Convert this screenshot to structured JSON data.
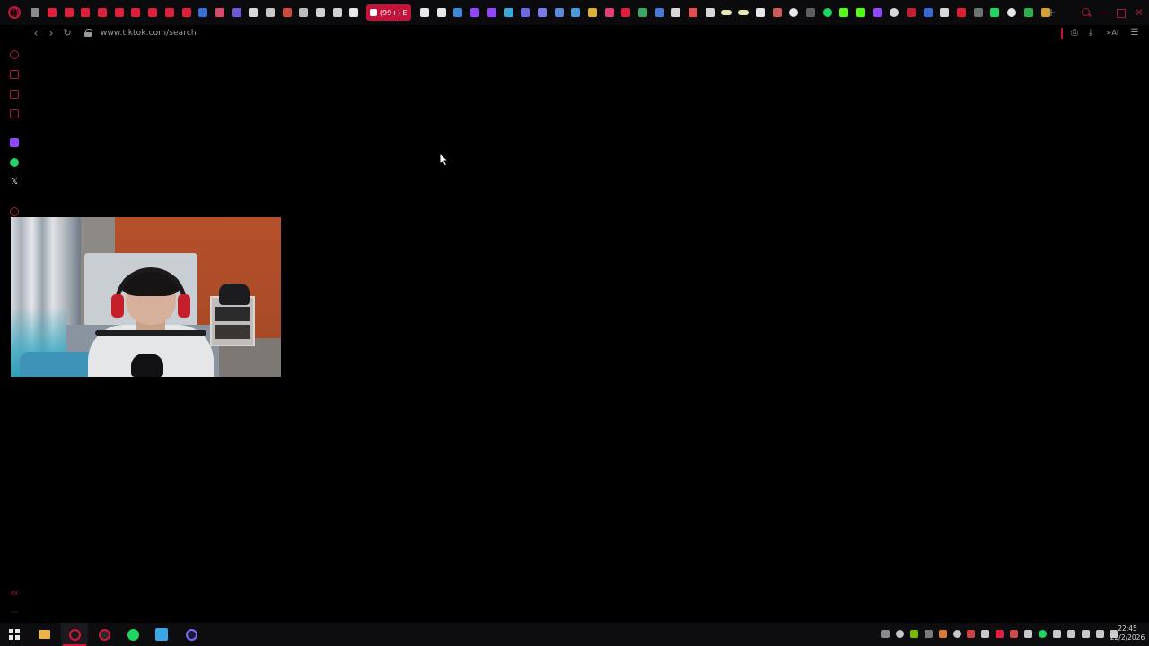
{
  "browser": {
    "active_tab_label": "(99+) E",
    "new_tab_glyph": "+",
    "url": "www.tiktok.com/search",
    "ai_label": "AI",
    "theme_accent": "#c4133a"
  },
  "tab_favicons": [
    {
      "icon": "mail-icon",
      "color": "#8a8a8a"
    },
    {
      "icon": "youtube-icon",
      "color": "#e0203a"
    },
    {
      "icon": "youtube-icon",
      "color": "#e0203a"
    },
    {
      "icon": "youtube-icon",
      "color": "#e0203a"
    },
    {
      "icon": "youtube-icon",
      "color": "#e0203a"
    },
    {
      "icon": "youtube-icon",
      "color": "#e0203a"
    },
    {
      "icon": "youtube-icon",
      "color": "#e0203a"
    },
    {
      "icon": "youtube-icon",
      "color": "#e0203a"
    },
    {
      "icon": "youtube-icon",
      "color": "#e0203a"
    },
    {
      "icon": "youtube-icon",
      "color": "#e0203a"
    },
    {
      "icon": "facebook-icon",
      "color": "#3b6fd8"
    },
    {
      "icon": "app-icon",
      "color": "#d64a6a"
    },
    {
      "icon": "app-icon",
      "color": "#6a5ad8"
    },
    {
      "icon": "document-icon",
      "color": "#d8d8d8"
    },
    {
      "icon": "app-icon",
      "color": "#c8c8c8"
    },
    {
      "icon": "mail-icon",
      "color": "#d24a3a"
    },
    {
      "icon": "speaker-icon",
      "color": "#bdbdbd"
    },
    {
      "icon": "wikipedia-icon",
      "color": "#d0d0d0"
    },
    {
      "icon": "document-icon",
      "color": "#d0d0d0"
    },
    {
      "icon": "tiktok-icon",
      "color": "#e8e8e8"
    },
    {
      "icon": "tiktok-icon",
      "color": "#e8e8e8"
    },
    {
      "icon": "app-icon",
      "color": "#e8e8e8"
    },
    {
      "icon": "app-icon",
      "color": "#3a8ad8"
    },
    {
      "icon": "twitch-icon",
      "color": "#9146ff"
    },
    {
      "icon": "twitch-icon",
      "color": "#9146ff"
    },
    {
      "icon": "app-icon",
      "color": "#3aa8d8"
    },
    {
      "icon": "app-icon",
      "color": "#6a6ae8"
    },
    {
      "icon": "app-icon",
      "color": "#7a7ae8"
    },
    {
      "icon": "app-icon",
      "color": "#5a8ad8"
    },
    {
      "icon": "app-icon",
      "color": "#4a9ad8"
    },
    {
      "icon": "app-icon",
      "color": "#e0b030"
    },
    {
      "icon": "instagram-icon",
      "color": "#e0407a"
    },
    {
      "icon": "youtube-icon",
      "color": "#e0203a"
    },
    {
      "icon": "drive-icon",
      "color": "#3aa860"
    },
    {
      "icon": "folder-icon",
      "color": "#4a7ad8"
    },
    {
      "icon": "app-icon",
      "color": "#d8d8d8"
    },
    {
      "icon": "app-icon",
      "color": "#e05050"
    },
    {
      "icon": "app-icon",
      "color": "#d8d8d8"
    },
    {
      "icon": "app-icon",
      "color": "#e8e8b0"
    },
    {
      "icon": "app-icon",
      "color": "#e8e8b0"
    },
    {
      "icon": "app-icon",
      "color": "#e8e8e8"
    },
    {
      "icon": "app-icon",
      "color": "#d05a5a"
    },
    {
      "icon": "google-icon",
      "color": "#e8e8e8"
    },
    {
      "icon": "app-icon",
      "color": "#606060"
    },
    {
      "icon": "spotify-icon",
      "color": "#1ed760"
    },
    {
      "icon": "kick-icon",
      "color": "#53fc18"
    },
    {
      "icon": "kick-icon",
      "color": "#53fc18"
    },
    {
      "icon": "twitch-icon",
      "color": "#9146ff"
    },
    {
      "icon": "settings-icon",
      "color": "#d8d8d8"
    },
    {
      "icon": "app-icon",
      "color": "#c02030"
    },
    {
      "icon": "app-icon",
      "color": "#3a6ad8"
    },
    {
      "icon": "app-icon",
      "color": "#d8d8d8"
    },
    {
      "icon": "app-icon",
      "color": "#e02030"
    },
    {
      "icon": "app-icon",
      "color": "#707070"
    },
    {
      "icon": "app-icon",
      "color": "#1ed760"
    },
    {
      "icon": "google-icon",
      "color": "#e8e8e8"
    },
    {
      "icon": "app-icon",
      "color": "#2ab04a"
    },
    {
      "icon": "app-icon",
      "color": "#d8a030"
    }
  ],
  "sidebar_icons": [
    {
      "icon": "history-icon",
      "color": "#b01a34"
    },
    {
      "icon": "wallet-icon",
      "color": "#b01a34"
    },
    {
      "icon": "messenger-icon",
      "color": "#b01a34"
    },
    {
      "icon": "notes-icon",
      "color": "#b01a34"
    },
    {
      "icon": "twitch-icon",
      "color": "#9146ff"
    },
    {
      "icon": "whatsapp-icon",
      "color": "#25d366"
    },
    {
      "icon": "x-icon",
      "color": "#e8e8e8"
    },
    {
      "icon": "add-icon",
      "color": "#b01a34"
    }
  ],
  "sidebar_footer": {
    "extensions_label": "ex",
    "more_label": "···"
  },
  "taskbar": {
    "time": "22:45",
    "date": "22/2/2026"
  },
  "taskbar_apps": [
    {
      "icon": "start-icon"
    },
    {
      "icon": "file-explorer-icon"
    },
    {
      "icon": "opera-gx-icon"
    },
    {
      "icon": "spotify-icon",
      "color": "#1ed760"
    },
    {
      "icon": "app-icon",
      "color": "#3aa8e8"
    },
    {
      "icon": "app-icon",
      "color": "#6a5ae8"
    }
  ],
  "tray_icons": [
    {
      "icon": "tray-icon",
      "color": "#8a8a8a"
    },
    {
      "icon": "steam-icon",
      "color": "#c8c8c8"
    },
    {
      "icon": "nvidia-icon",
      "color": "#76b900"
    },
    {
      "icon": "tray-icon",
      "color": "#7a7a7a"
    },
    {
      "icon": "tray-icon",
      "color": "#e07a30"
    },
    {
      "icon": "discord-icon",
      "color": "#c8c8c8"
    },
    {
      "icon": "tray-icon",
      "color": "#d04040"
    },
    {
      "icon": "tray-icon",
      "color": "#c8c8c8"
    },
    {
      "icon": "tray-icon",
      "color": "#e02040"
    },
    {
      "icon": "tray-icon",
      "color": "#d04a4a"
    },
    {
      "icon": "tray-icon",
      "color": "#c8c8c8"
    },
    {
      "icon": "spotify-icon",
      "color": "#1ed760"
    },
    {
      "icon": "tray-icon",
      "color": "#c8c8c8"
    },
    {
      "icon": "usb-icon",
      "color": "#c8c8c8"
    },
    {
      "icon": "mic-icon",
      "color": "#c8c8c8"
    },
    {
      "icon": "network-icon",
      "color": "#c8c8c8"
    },
    {
      "icon": "volume-icon",
      "color": "#c8c8c8"
    }
  ]
}
